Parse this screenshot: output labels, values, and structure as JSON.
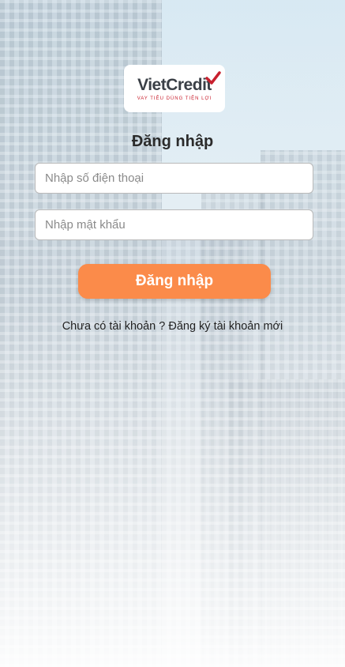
{
  "brand": {
    "logo_part1": "Viet",
    "logo_part2": "Credit",
    "tagline": "VAY TIÊU DÙNG TIỆN LỢI",
    "check_color": "#c8202e"
  },
  "login": {
    "title": "Đăng nhập",
    "phone_placeholder": "Nhập số điện thoại",
    "password_placeholder": "Nhập mật khẩu",
    "submit_label": "Đăng nhập",
    "accent_color": "#fb8b4a"
  },
  "register": {
    "prompt": "Chưa có tài khoản ? ",
    "link_label": "Đăng ký tài khoản mới"
  }
}
